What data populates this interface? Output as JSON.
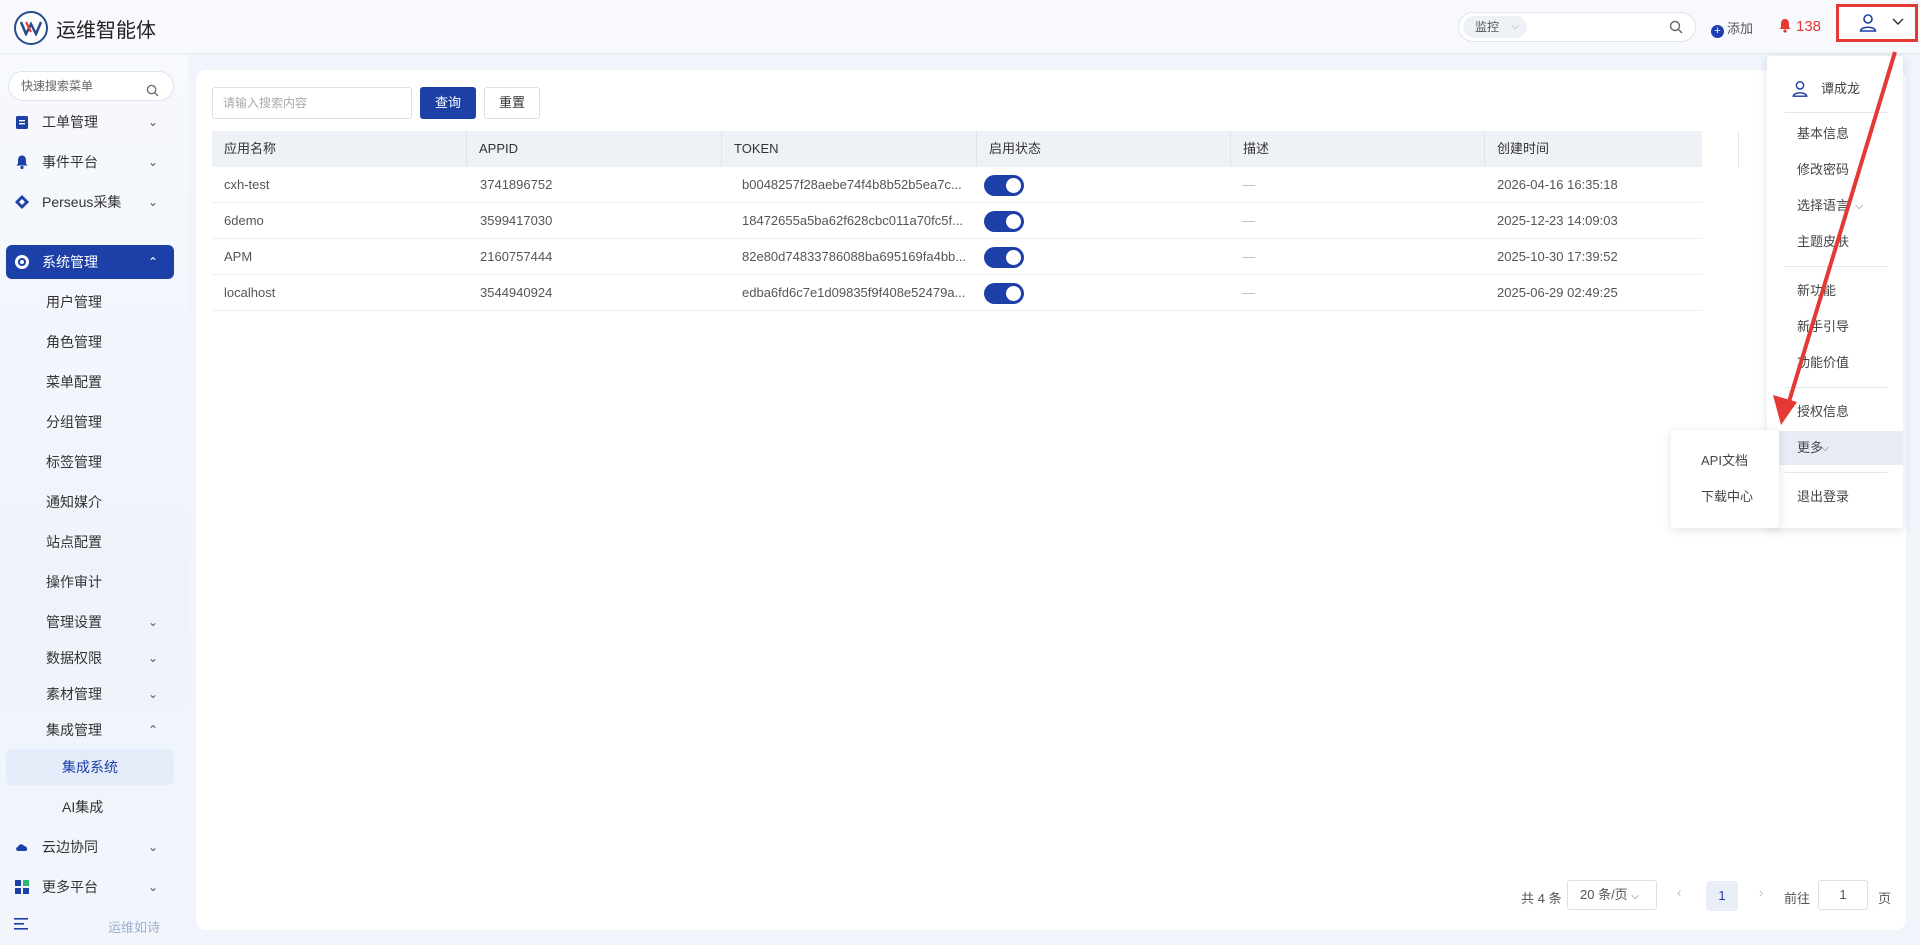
{
  "header": {
    "app_title": "运维智能体",
    "search_scope": "监控",
    "add_label": "添加",
    "alert_count": "138"
  },
  "sidebar": {
    "search_placeholder": "快速搜索菜单",
    "items": [
      {
        "label": "工单管理",
        "icon": "ticket-icon"
      },
      {
        "label": "事件平台",
        "icon": "bell-icon"
      },
      {
        "label": "Perseus采集",
        "icon": "diamond-icon"
      },
      {
        "label": "系统管理",
        "icon": "gear-icon"
      }
    ],
    "sub_items": [
      "用户管理",
      "角色管理",
      "菜单配置",
      "分组管理",
      "标签管理",
      "通知媒介",
      "站点配置",
      "操作审计",
      "管理设置",
      "数据权限",
      "素材管理",
      "集成管理"
    ],
    "deep_items": [
      "集成系统",
      "AI集成"
    ],
    "bottom_items": [
      {
        "label": "云边协同",
        "icon": "cloud-icon"
      },
      {
        "label": "更多平台",
        "icon": "grid-icon"
      }
    ],
    "footer_label": "运维如诗"
  },
  "toolbar": {
    "search_placeholder": "请输入搜索内容",
    "query_label": "查询",
    "reset_label": "重置"
  },
  "table": {
    "columns": [
      "应用名称",
      "APPID",
      "TOKEN",
      "启用状态",
      "描述",
      "创建时间"
    ],
    "rows": [
      {
        "name": "cxh-test",
        "appid": "3741896752",
        "token": "b0048257f28aebe74f4b8b52b5ea7c...",
        "desc": "—",
        "created": "2026-04-16 16:35:18"
      },
      {
        "name": "6demo",
        "appid": "3599417030",
        "token": "18472655a5ba62f628cbc011a70fc5f...",
        "desc": "—",
        "created": "2025-12-23 14:09:03"
      },
      {
        "name": "APM",
        "appid": "2160757444",
        "token": "82e80d74833786088ba695169fa4bb...",
        "desc": "—",
        "created": "2025-10-30 17:39:52"
      },
      {
        "name": "localhost",
        "appid": "3544940924",
        "token": "edba6fd6c7e1d09835f9f408e52479a...",
        "desc": "—",
        "created": "2025-06-29 02:49:25"
      }
    ]
  },
  "pagination": {
    "total": "共 4 条",
    "page_size": "20 条/页",
    "current_page": "1",
    "goto_label": "前往",
    "goto_value": "1",
    "page_unit": "页"
  },
  "user_menu": {
    "user_name": "谭成龙",
    "items": [
      "基本信息",
      "修改密码",
      "选择语言",
      "主题皮肤",
      "新功能",
      "新手引导",
      "功能价值",
      "授权信息",
      "更多",
      "退出登录"
    ],
    "more_submenu": [
      "API文档",
      "下载中心"
    ]
  },
  "colors": {
    "primary": "#1d3fa8",
    "alert": "#e53935"
  }
}
